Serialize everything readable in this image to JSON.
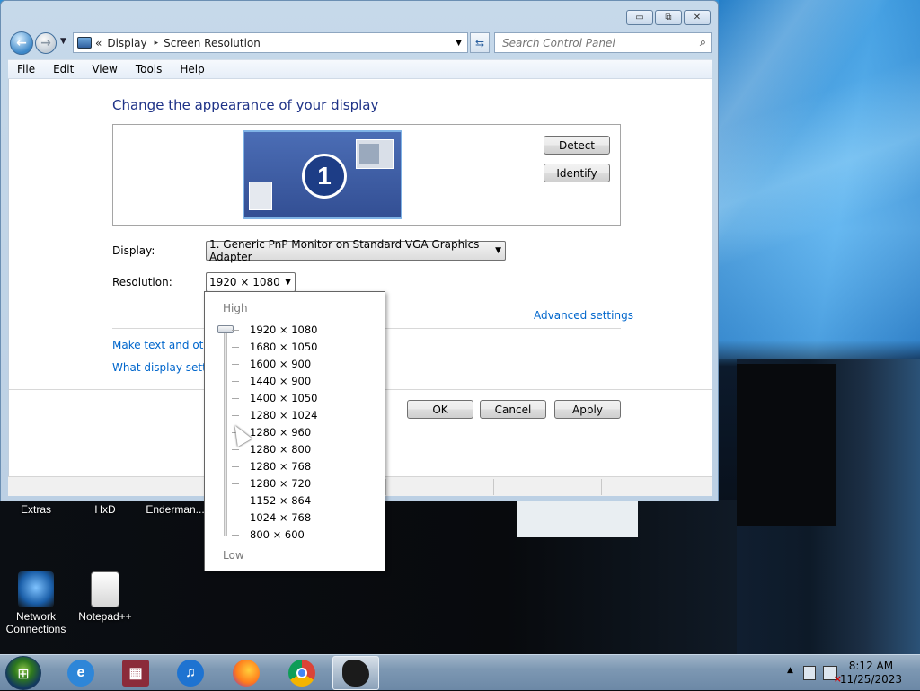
{
  "window": {
    "titlebar": {
      "minimize_glyph": "▭",
      "restore_glyph": "⧉",
      "close_glyph": "✕"
    },
    "address": {
      "crumbs_prefix": "«",
      "crumb1": "Display",
      "crumb_sep": "▸",
      "crumb2": "Screen Resolution"
    },
    "search": {
      "placeholder": "Search Control Panel"
    },
    "menu": [
      "File",
      "Edit",
      "View",
      "Tools",
      "Help"
    ]
  },
  "page": {
    "heading": "Change the appearance of your display",
    "monitor_number": "1",
    "detect_label": "Detect",
    "identify_label": "Identify",
    "display_label": "Display:",
    "display_value": "1. Generic PnP Monitor on Standard VGA Graphics Adapter",
    "resolution_label": "Resolution:",
    "resolution_value": "1920 × 1080",
    "advanced_link": "Advanced settings",
    "link_text_size": "Make text and other",
    "link_which_settings": "What display setting",
    "ok_label": "OK",
    "cancel_label": "Cancel",
    "apply_label": "Apply"
  },
  "resolution_popup": {
    "high_label": "High",
    "low_label": "Low",
    "options": [
      "1920 × 1080",
      "1680 × 1050",
      "1600 × 900",
      "1440 × 900",
      "1400 × 1050",
      "1280 × 1024",
      "1280 × 960",
      "1280 × 800",
      "1280 × 768",
      "1280 × 720",
      "1152 × 864",
      "1024 × 768",
      "800 × 600"
    ],
    "selected_index": 0
  },
  "desktop_icons": {
    "extras": "Extras",
    "hxd": "HxD",
    "enderman": "Enderman...",
    "network": "Network Connections",
    "notepadpp": "Notepad++"
  },
  "taskbar": {
    "apps": [
      "start-orb",
      "internet-explorer-icon",
      "winrar-icon",
      "itunes-icon",
      "firefox-icon",
      "chrome-icon",
      "paint-icon"
    ],
    "time": "8:12 AM",
    "date": "11/25/2023"
  },
  "colors": {
    "heading": "#1e3287",
    "link": "#0066cc",
    "selection": "#3399ff"
  }
}
